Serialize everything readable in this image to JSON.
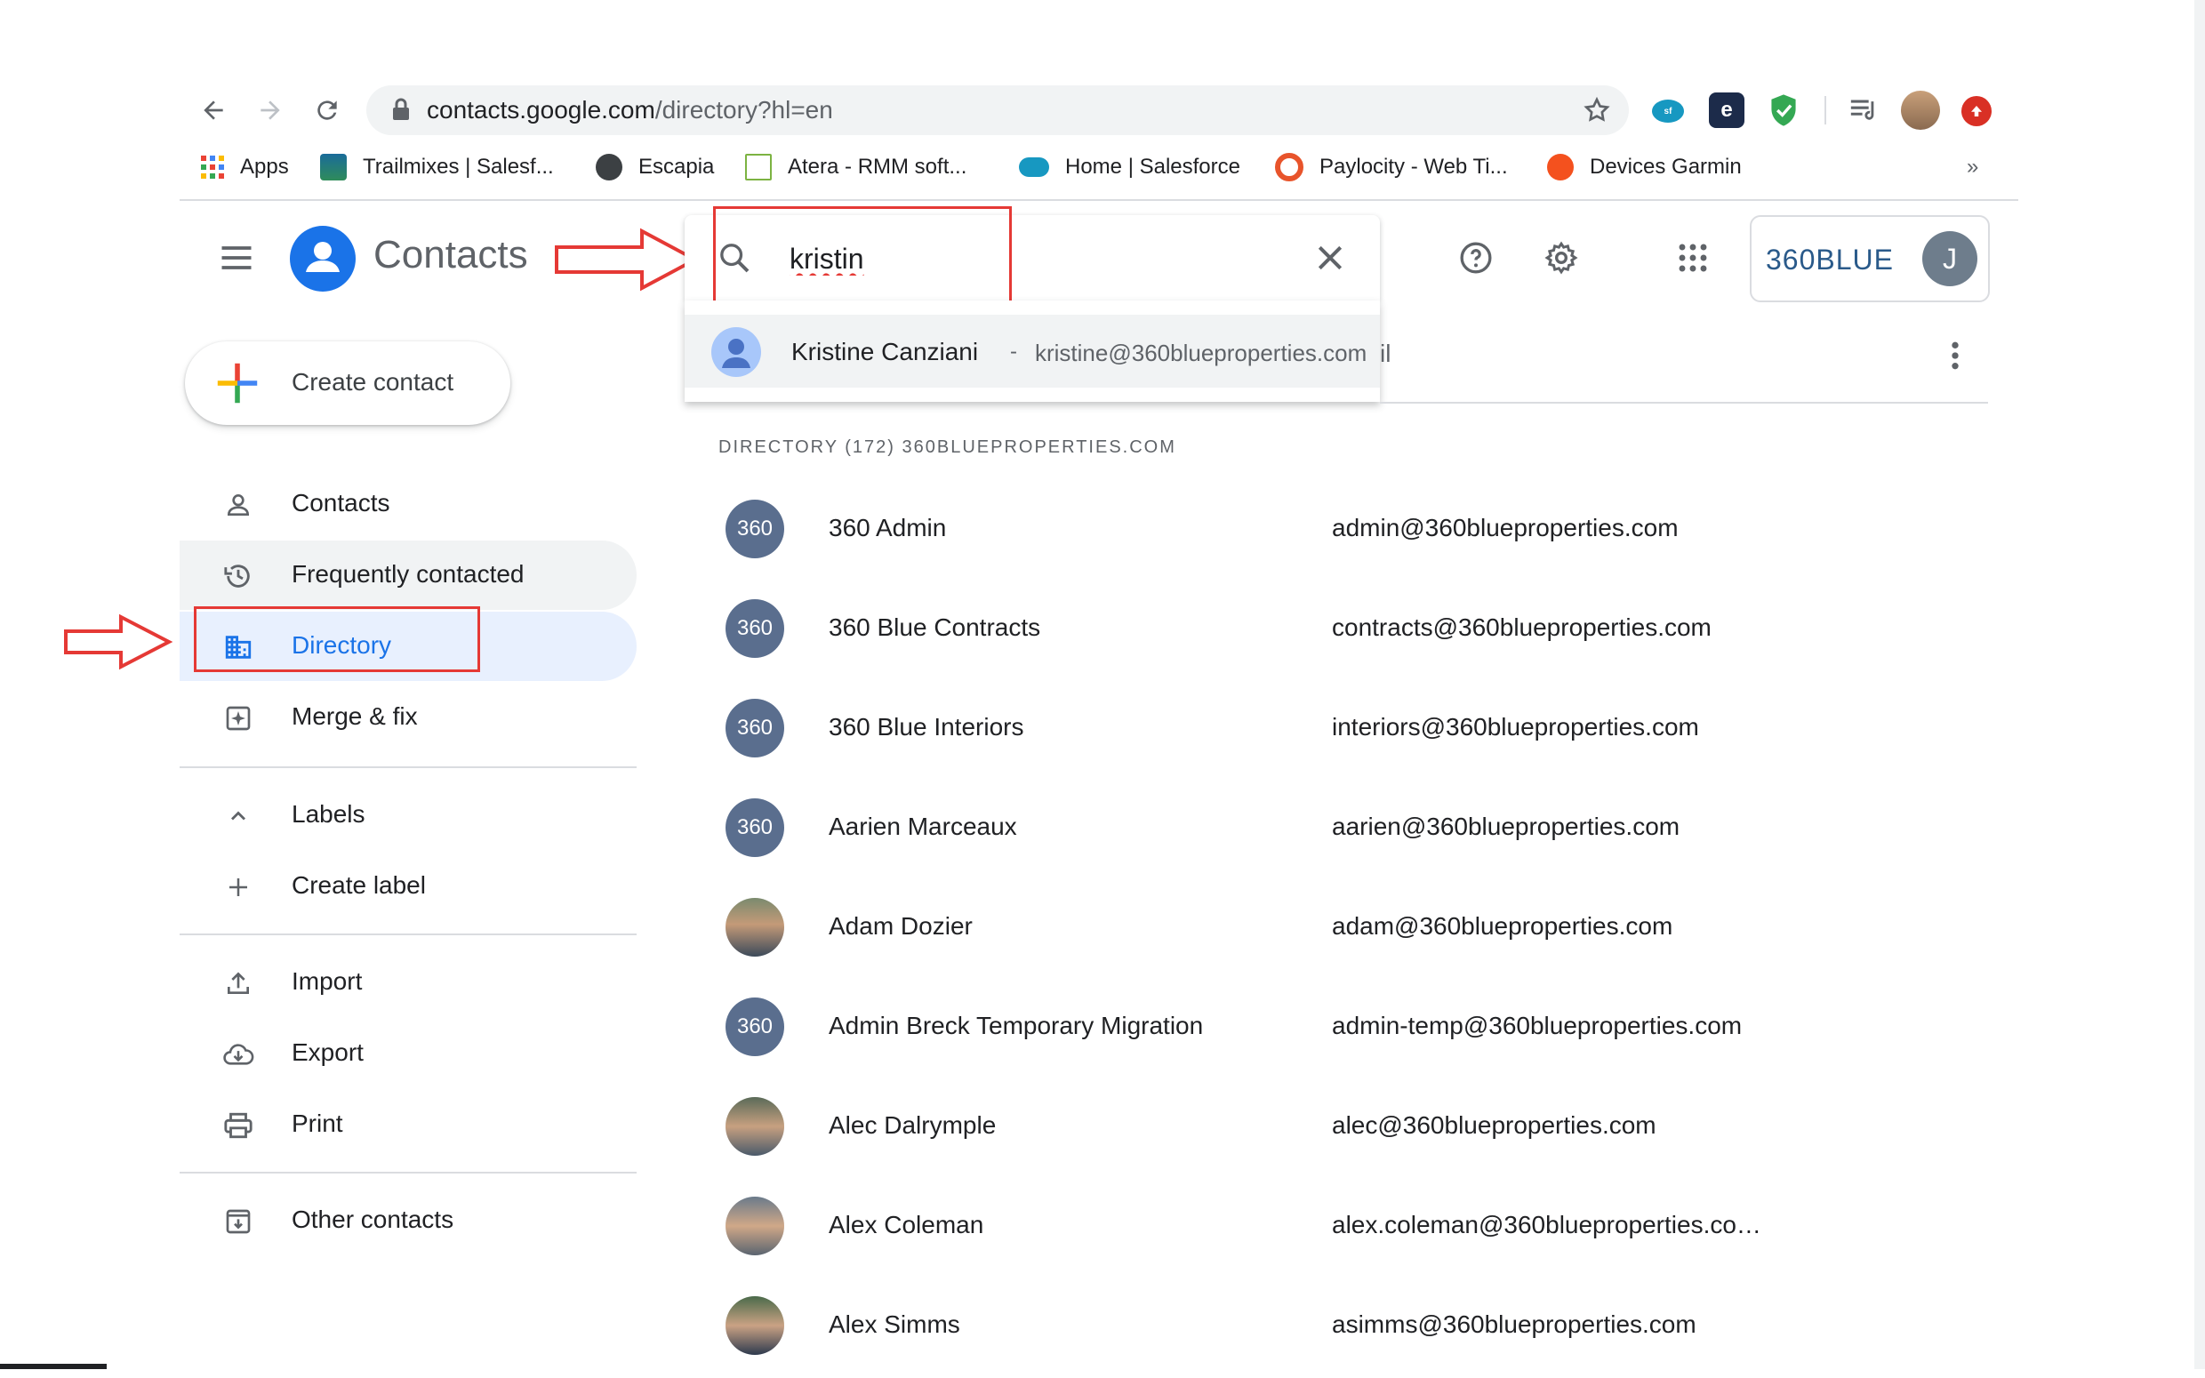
{
  "browser": {
    "url_host": "contacts.google.com",
    "url_path": "/directory?hl=en",
    "bookmarks": [
      {
        "label": "Apps"
      },
      {
        "label": "Trailmixes | Salesf..."
      },
      {
        "label": "Escapia"
      },
      {
        "label": "Atera - RMM soft..."
      },
      {
        "label": "Home | Salesforce"
      },
      {
        "label": "Paylocity - Web Ti..."
      },
      {
        "label": "Devices Garmin"
      }
    ],
    "more_bookmarks": "»",
    "icons": [
      "back-icon",
      "forward-icon",
      "reload-icon",
      "lock-icon",
      "star-icon",
      "salesforce-ext-icon",
      "e-ext-icon",
      "shield-ext-icon",
      "reading-list-icon",
      "profile-photo",
      "update-icon"
    ]
  },
  "header": {
    "app_title": "Contacts",
    "search_value": "kristin",
    "brand": "360BLUE",
    "account_initial": "J"
  },
  "suggestion": {
    "name": "Kristine Canziani",
    "separator": "-",
    "email": "kristine@360blueproperties.com",
    "clipped_text": "il"
  },
  "sidebar": {
    "create_label": "Create contact",
    "items": [
      {
        "label": "Contacts",
        "icon": "person-icon"
      },
      {
        "label": "Frequently contacted",
        "icon": "history-icon"
      },
      {
        "label": "Directory",
        "icon": "domain-icon"
      },
      {
        "label": "Merge & fix",
        "icon": "merge-icon"
      }
    ],
    "labels_heading": "Labels",
    "create_label_item": "Create label",
    "tools": [
      {
        "label": "Import",
        "icon": "upload-icon"
      },
      {
        "label": "Export",
        "icon": "cloud-download-icon"
      },
      {
        "label": "Print",
        "icon": "print-icon"
      }
    ],
    "other_contacts": "Other contacts"
  },
  "directory": {
    "header": "DIRECTORY (172) 360BLUEPROPERTIES.COM",
    "rows": [
      {
        "avatar": "360",
        "name": "360 Admin",
        "email": "admin@360blueproperties.com"
      },
      {
        "avatar": "360",
        "name": "360 Blue Contracts",
        "email": "contracts@360blueproperties.com"
      },
      {
        "avatar": "360",
        "name": "360 Blue Interiors",
        "email": "interiors@360blueproperties.com"
      },
      {
        "avatar": "360",
        "name": "Aarien Marceaux",
        "email": "aarien@360blueproperties.com"
      },
      {
        "avatar": "",
        "name": "Adam Dozier",
        "email": "adam@360blueproperties.com"
      },
      {
        "avatar": "360",
        "name": "Admin Breck Temporary Migration",
        "email": "admin-temp@360blueproperties.com"
      },
      {
        "avatar": "",
        "name": "Alec Dalrymple",
        "email": "alec@360blueproperties.com"
      },
      {
        "avatar": "",
        "name": "Alex Coleman",
        "email": "alex.coleman@360blueproperties.co…"
      },
      {
        "avatar": "",
        "name": "Alex Simms",
        "email": "asimms@360blueproperties.com"
      }
    ]
  },
  "colors": {
    "accent": "#1a73e8",
    "selected_bg": "#e8f0fe",
    "hover_bg": "#f1f3f4",
    "annotation_red": "#e53935",
    "avatar_bg": "#5a6e8e"
  }
}
